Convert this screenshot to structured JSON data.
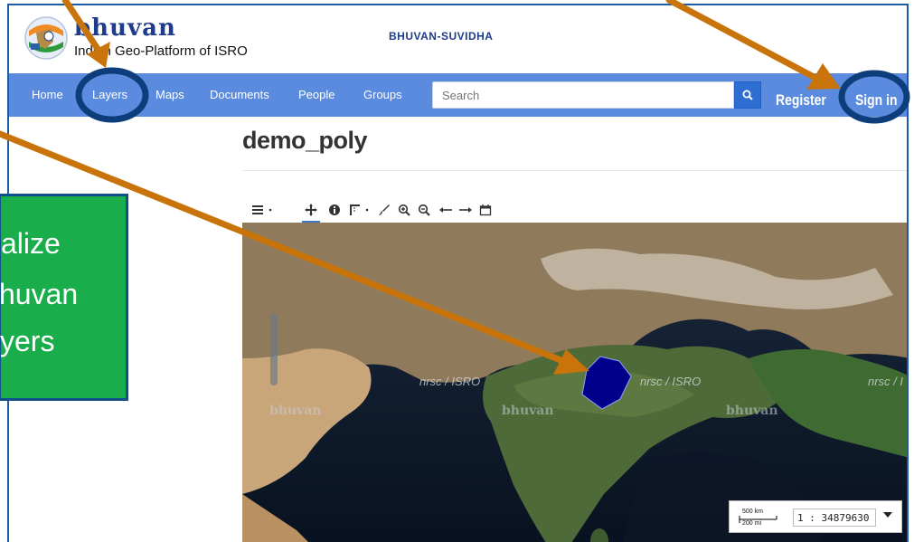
{
  "header": {
    "brand": "bhuvan",
    "tagline": "Indian Geo-Platform of ISRO",
    "center_title": "BHUVAN-SUVIDHA"
  },
  "nav": {
    "items": [
      "Home",
      "Layers",
      "Maps",
      "Documents",
      "People",
      "Groups"
    ],
    "search_placeholder": "Search",
    "register": "Register",
    "sign_in": "Sign in"
  },
  "page": {
    "title": "demo_poly"
  },
  "toolbar": {
    "icons": [
      "menu-icon",
      "pan-icon",
      "info-icon",
      "measure-icon",
      "draw-icon",
      "zoom-in-icon",
      "zoom-out-icon",
      "back-icon",
      "forward-icon",
      "print-icon"
    ]
  },
  "map": {
    "watermarks": [
      "nrsc / ISRO",
      "nrsc / ISRO",
      "nrsc / I",
      "bhuvan",
      "bhuvan",
      "bhuvan"
    ],
    "scale_km": "500 km",
    "scale_mi": "200 mi",
    "ratio": "1 : 34879630",
    "polygon_color": "#00008b"
  },
  "callout": {
    "lines": [
      "alize",
      "huvan",
      "yers"
    ],
    "color": "#1aad4b"
  },
  "annotation_color": "#c8740b"
}
